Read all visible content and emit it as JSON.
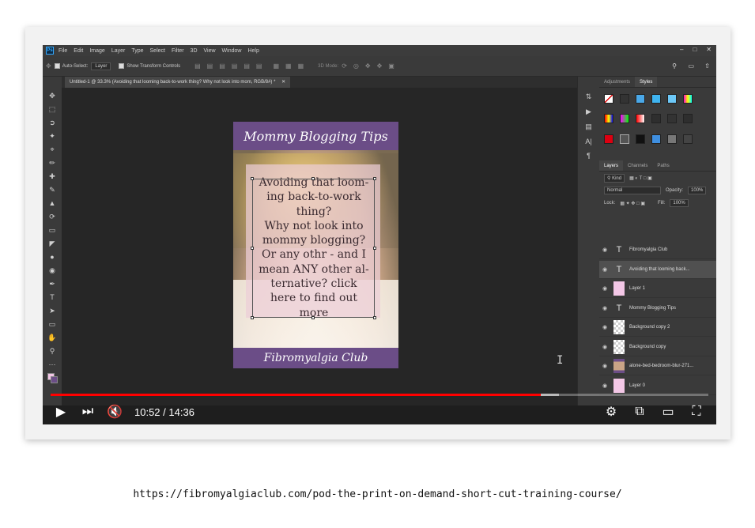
{
  "photoshop": {
    "menu": [
      "File",
      "Edit",
      "Image",
      "Layer",
      "Type",
      "Select",
      "Filter",
      "3D",
      "View",
      "Window",
      "Help"
    ],
    "options": {
      "auto_select_label": "Auto-Select:",
      "auto_select_value": "Layer",
      "show_transform_label": "Show Transform Controls",
      "mode_3d_label": "3D Mode:"
    },
    "document_tab": "Untitled-1 @ 33.3% (Avoiding that looming back-to-work thing? Why not look into mom, RGB/8#) *",
    "document": {
      "header_title": "Mommy Blogging Tips",
      "body_text": "Avoiding that loom-\ning back-to-work\nthing?\nWhy not look into\nmommy blogging?\nOr any othr - and I\nmean ANY other al-\nternative? click\nhere to find out\nmore",
      "footer_title": "Fibromyalgia Club"
    },
    "right_panel": {
      "top_tabs": [
        "Adjustments",
        "Styles"
      ],
      "layer_tabs": [
        "Layers",
        "Channels",
        "Paths"
      ],
      "kind_label": "Kind",
      "blend_mode": "Normal",
      "opacity_label": "Opacity:",
      "opacity_value": "100%",
      "lock_label": "Lock:",
      "fill_label": "Fill:",
      "fill_value": "100%",
      "layers": [
        {
          "name": "Fibromyalgia Club",
          "thumb": "type"
        },
        {
          "name": "Avoiding that looming back...",
          "thumb": "type",
          "selected": true
        },
        {
          "name": "Layer 1",
          "thumb": "pink"
        },
        {
          "name": "Mommy Blogging Tips",
          "thumb": "type"
        },
        {
          "name": "Background copy 2",
          "thumb": "check"
        },
        {
          "name": "Background copy",
          "thumb": "check"
        },
        {
          "name": "alone-bed-bedroom-blur-271...",
          "thumb": "photo"
        },
        {
          "name": "Layer 0",
          "thumb": "pink"
        }
      ]
    }
  },
  "player": {
    "current_time": "10:52",
    "duration": "14:36",
    "time_separator": " / ",
    "progress_fraction": 0.745,
    "buffered_fraction": 0.773,
    "accent_color": "#ff0000"
  },
  "footer_url": "https://fibromyalgiaclub.com/pod-the-print-on-demand-short-cut-training-course/"
}
